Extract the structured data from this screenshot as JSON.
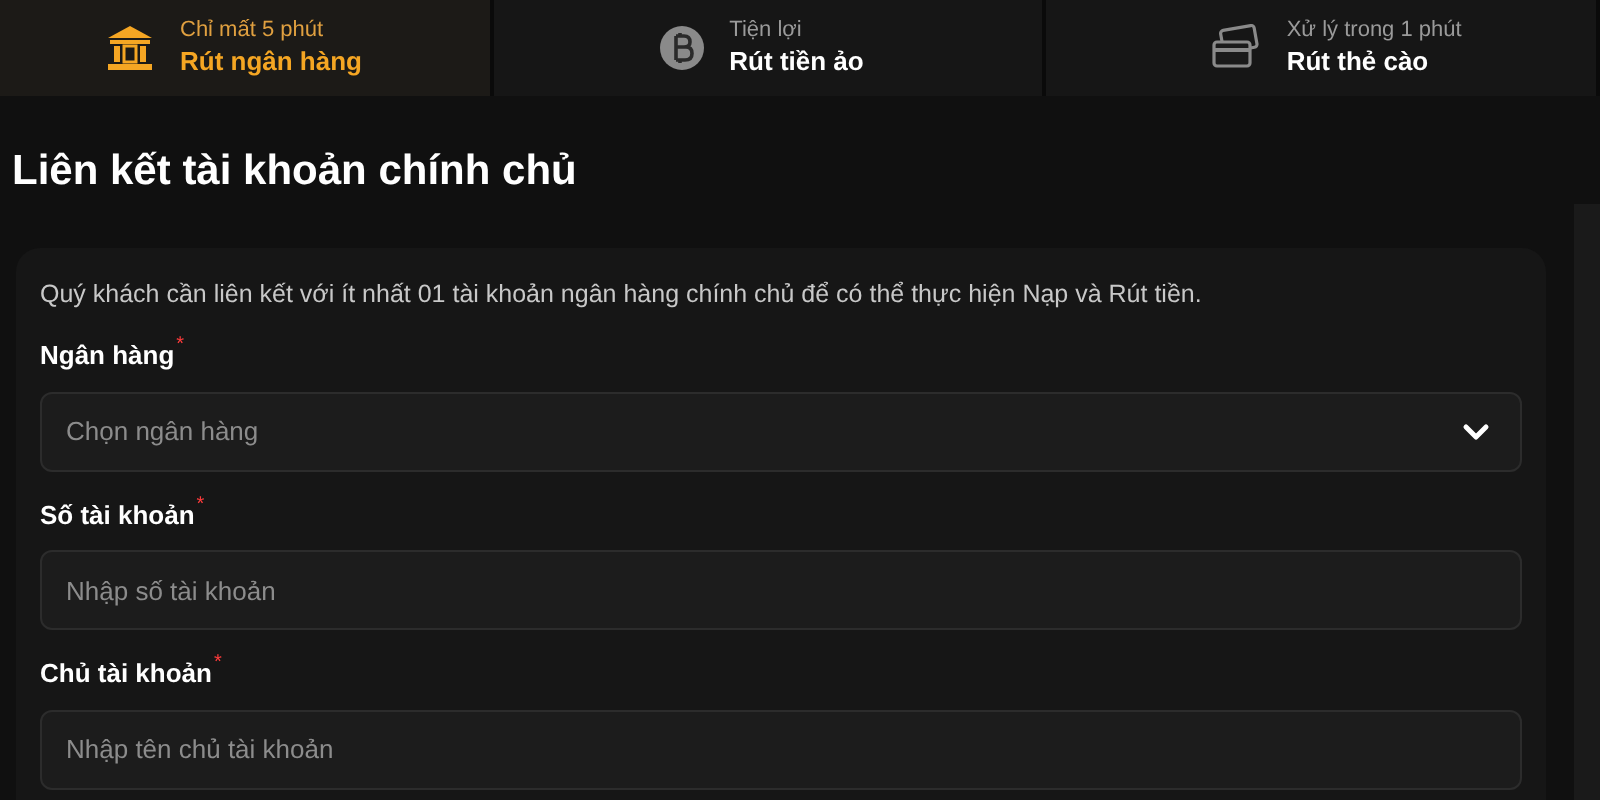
{
  "tabs": [
    {
      "kind": "bank",
      "hint": "Chỉ mất 5 phút",
      "label": "Rút ngân hàng",
      "selected": true
    },
    {
      "kind": "crypto",
      "hint": "Tiện lợi",
      "label": "Rút tiền ảo",
      "selected": false
    },
    {
      "kind": "card",
      "hint": "Xử lý trong 1 phút",
      "label": "Rút thẻ cào",
      "selected": false
    }
  ],
  "heading": "Liên kết tài khoản chính chủ",
  "form": {
    "notice": "Quý khách cần liên kết với ít nhất 01 tài khoản ngân hàng chính chủ để có thể thực hiện Nạp và Rút tiền.",
    "fields": [
      {
        "kind": "select",
        "label": "Ngân hàng",
        "required_mark": "*",
        "placeholder": "Chọn ngân hàng"
      },
      {
        "kind": "text",
        "label": "Số tài khoản",
        "required_mark": "*",
        "placeholder": "Nhập số tài khoản"
      },
      {
        "kind": "text",
        "label": "Chủ tài khoản",
        "required_mark": "*",
        "placeholder": "Nhập tên chủ tài khoản"
      }
    ]
  }
}
